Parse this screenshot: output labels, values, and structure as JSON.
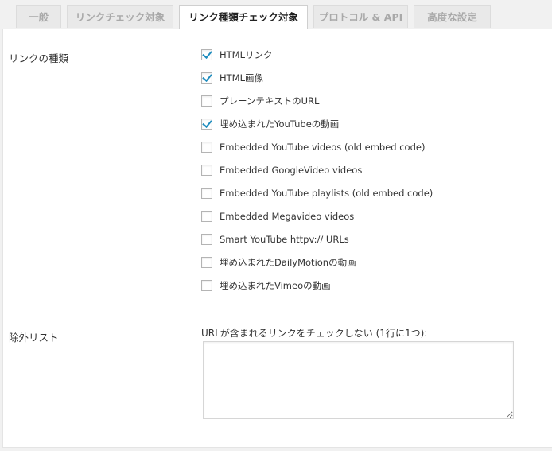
{
  "tabs": [
    {
      "label": "一般",
      "active": false
    },
    {
      "label": "リンクチェック対象",
      "active": false
    },
    {
      "label": "リンク種類チェック対象",
      "active": true
    },
    {
      "label": "プロトコル & API",
      "active": false
    },
    {
      "label": "高度な設定",
      "active": false
    }
  ],
  "link_types": {
    "label": "リンクの種類",
    "options": [
      {
        "label": "HTMLリンク",
        "checked": true
      },
      {
        "label": "HTML画像",
        "checked": true
      },
      {
        "label": "プレーンテキストのURL",
        "checked": false
      },
      {
        "label": "埋め込まれたYouTubeの動画",
        "checked": true
      },
      {
        "label": "Embedded YouTube videos (old embed code)",
        "checked": false
      },
      {
        "label": "Embedded GoogleVideo videos",
        "checked": false
      },
      {
        "label": "Embedded YouTube playlists (old embed code)",
        "checked": false
      },
      {
        "label": "Embedded Megavideo videos",
        "checked": false
      },
      {
        "label": "Smart YouTube httpv:// URLs",
        "checked": false
      },
      {
        "label": "埋め込まれたDailyMotionの動画",
        "checked": false
      },
      {
        "label": "埋め込まれたVimeoの動画",
        "checked": false
      }
    ]
  },
  "exclusion": {
    "label": "除外リスト",
    "description": "URLが含まれるリンクをチェックしない (1行に1つ):",
    "value": ""
  },
  "colors": {
    "accent_check": "#1e8cbe",
    "tab_inactive_text": "#a9a9a9",
    "background": "#f1f1f1"
  }
}
